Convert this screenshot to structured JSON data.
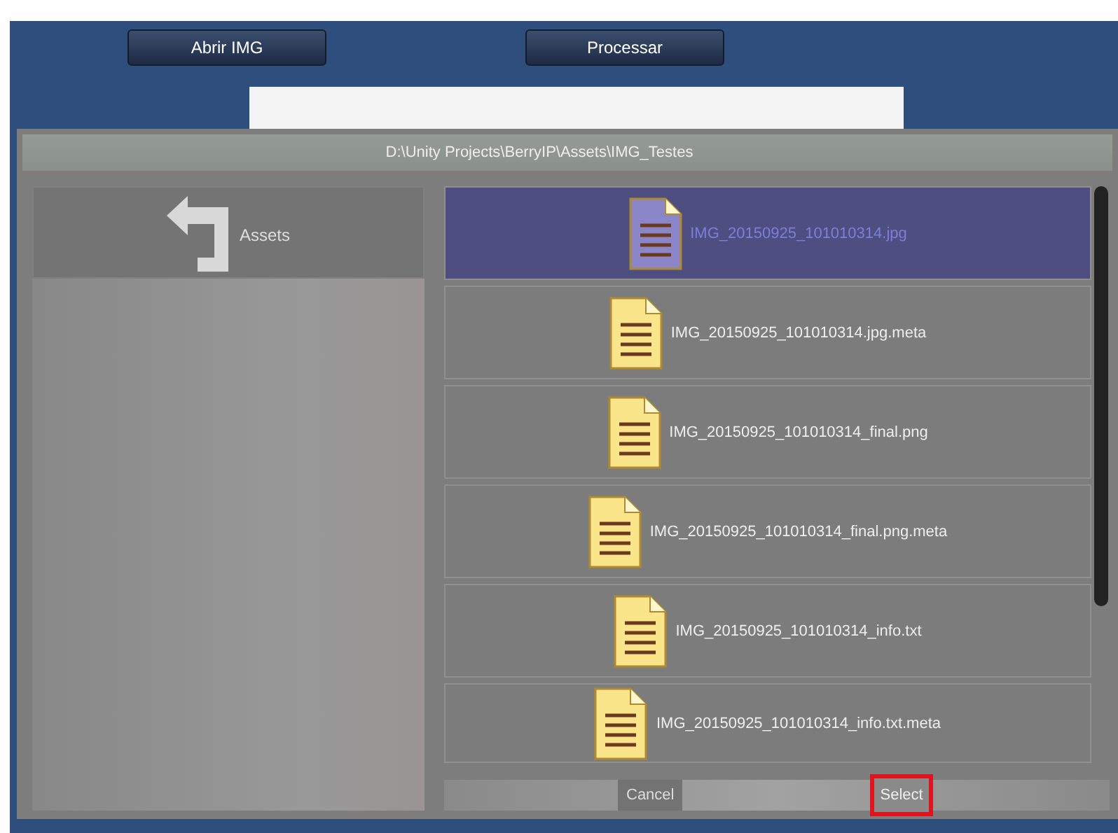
{
  "toolbar": {
    "buttons": [
      "Abrir IMG",
      "Processar"
    ]
  },
  "file_browser": {
    "path": "D:\\Unity Projects\\BerryIP\\Assets\\IMG_Testes",
    "up_button": {
      "label": "Assets"
    },
    "files": [
      {
        "name": "IMG_20150925_101010314.jpg",
        "selected": true
      },
      {
        "name": "IMG_20150925_101010314.jpg.meta",
        "selected": false
      },
      {
        "name": "IMG_20150925_101010314_final.png",
        "selected": false
      },
      {
        "name": "IMG_20150925_101010314_final.png.meta",
        "selected": false
      },
      {
        "name": "IMG_20150925_101010314_info.txt",
        "selected": false
      },
      {
        "name": "IMG_20150925_101010314_info.txt.meta",
        "selected": false
      }
    ],
    "cancel_button": {
      "label": "Cancel"
    },
    "select_button": {
      "label": "Select",
      "highlighted": true
    }
  }
}
